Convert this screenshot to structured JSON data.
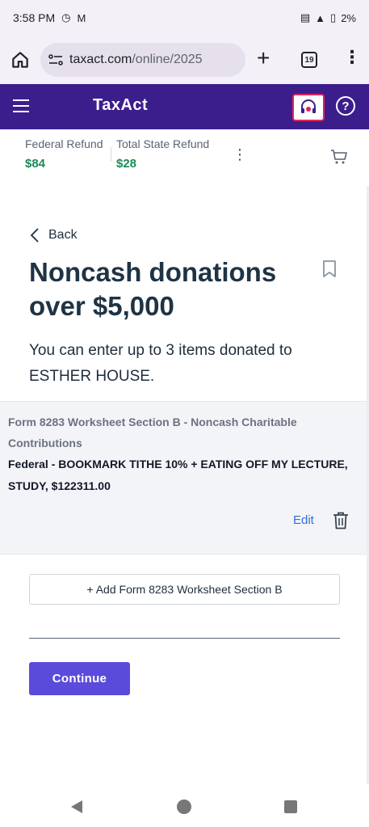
{
  "status_bar": {
    "time": "3:58 PM",
    "battery": "2%"
  },
  "browser": {
    "url_host": "taxact.com",
    "url_path": "/online/2025",
    "tab_count": "19"
  },
  "header": {
    "logo": "TaxAct"
  },
  "refund_bar": {
    "federal_label": "Federal Refund",
    "federal_value": "$84",
    "state_label": "Total State Refund",
    "state_value": "$28"
  },
  "main": {
    "back_label": "Back",
    "title": "Noncash donations over $5,000",
    "intro": "You can enter up to 3 items donated to ESTHER HOUSE."
  },
  "card": {
    "title": "Form 8283 Worksheet Section B - Noncash Charitable Contributions",
    "detail": "Federal - BOOKMARK TITHE 10% + EATING OFF MY LECTURE, STUDY, $122311.00",
    "edit_label": "Edit"
  },
  "actions": {
    "add_label": "+ Add Form 8283 Worksheet Section B",
    "continue_label": "Continue"
  },
  "colors": {
    "header_bg": "#3b1e8c",
    "refund_green": "#1b8a5a",
    "continue_bg": "#5b4bdb",
    "edit_link": "#2e6fd8"
  }
}
